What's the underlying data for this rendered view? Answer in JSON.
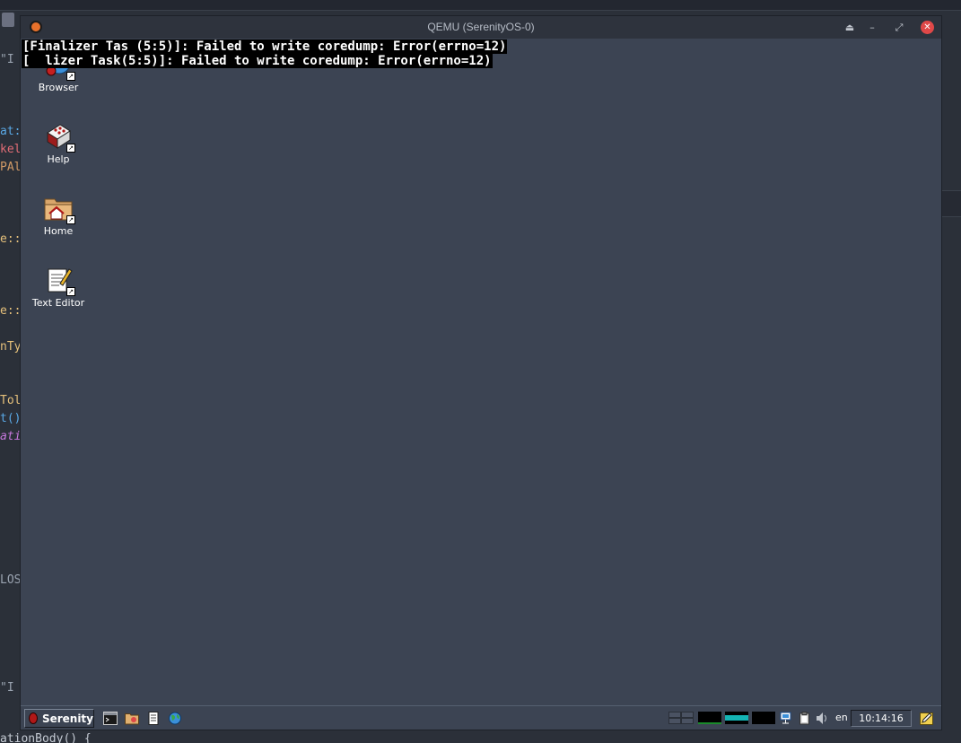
{
  "host_background": {
    "code_fragments": [
      "\"I",
      "at:",
      "kel",
      "PAl",
      "e::",
      "e::",
      "nTy",
      "Tol",
      "t()",
      "ati",
      "LOS",
      "\"I",
      "ationBody() {"
    ]
  },
  "qemu_window": {
    "title": "QEMU (SerenityOS-0)",
    "controls": {
      "eject": "⏏",
      "minimize": "–",
      "restore": "⤢",
      "close": "✕"
    }
  },
  "console": {
    "lines": [
      "[Finalizer Tas (5:5)]: Failed to write coredump: Error(errno=12)",
      "[  lizer Task(5:5)]: Failed to write coredump: Error(errno=12)"
    ]
  },
  "desktop": {
    "icons": [
      {
        "label": "Browser",
        "icon": "browser-globe-icon"
      },
      {
        "label": "Help",
        "icon": "help-book-icon"
      },
      {
        "label": "Home",
        "icon": "home-folder-icon"
      },
      {
        "label": "Text Editor",
        "icon": "text-editor-icon"
      }
    ]
  },
  "taskbar": {
    "start_label": "Serenity",
    "quick_launch": [
      "terminal-icon",
      "file-manager-icon",
      "text-editor-icon",
      "browser-icon"
    ],
    "tray": {
      "keyboard_layout": "en",
      "clock": "10:14:16"
    }
  },
  "colors": {
    "desktop": "#3c4453",
    "titlebar": "#2e333d",
    "close_button": "#e04848",
    "graph_green": "#1a8a2a",
    "graph_cyan": "#14b4b4"
  }
}
